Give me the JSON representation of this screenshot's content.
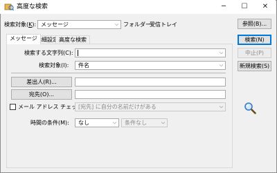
{
  "window": {
    "title": "高度な検索",
    "controls": {
      "minimize": "─",
      "maximize": "☐",
      "close": "✕"
    }
  },
  "top": {
    "search_target_label": "検索対象(",
    "search_target_key": "K",
    "search_target_label_end": "):",
    "search_target_value": "メッセージ",
    "folder_label": "フォルダー:",
    "folder_value": "受信トレイ",
    "browse_button": "参照(B)..."
  },
  "tabs": [
    {
      "label": "メッセージ",
      "active": true
    },
    {
      "label": "詳細設定",
      "active": false
    },
    {
      "label": "高度な検索",
      "active": false
    }
  ],
  "form": {
    "search_string_label": "検索する文字列(C):",
    "search_string_value": "",
    "search_in_label": "検索対象(I):",
    "search_in_value": "件名",
    "from_button": "差出人(R)...",
    "to_button": "宛先(O)...",
    "email_check_label": "メール アドレス チェック(W):",
    "email_check_value": "[宛先] に自分の名前だけがある",
    "time_label": "時間の条件(M):",
    "time_value": "なし",
    "time_condition_value": "条件なし"
  },
  "side_buttons": {
    "search": "検索(N)",
    "stop": "中止(P)",
    "new_search": "新規検索(S)"
  },
  "icons": {
    "magnifier": "search-icon",
    "app": "app-icon"
  },
  "colors": {
    "default_button_border": "#0078d7",
    "accent_blue": "#0078d7"
  }
}
